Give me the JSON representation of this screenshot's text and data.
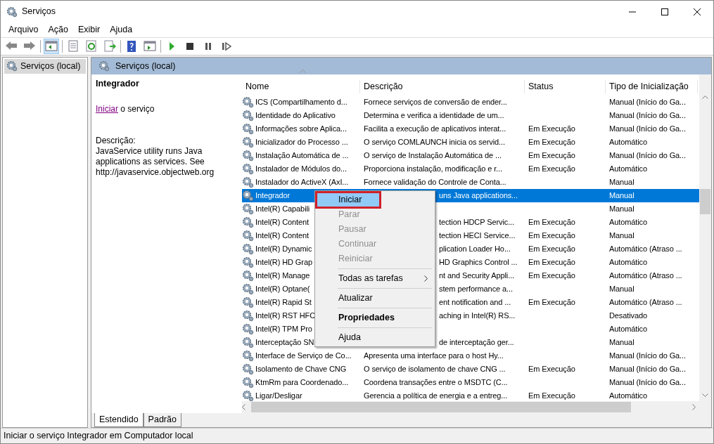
{
  "window": {
    "title": "Serviços"
  },
  "menu_bar": [
    "Arquivo",
    "Ação",
    "Exibir",
    "Ajuda"
  ],
  "toolbar": [
    {
      "kind": "back",
      "pressed": false
    },
    {
      "kind": "forward",
      "pressed": false
    },
    {
      "kind": "sep"
    },
    {
      "kind": "tree",
      "pressed": true
    },
    {
      "kind": "sep"
    },
    {
      "kind": "props",
      "pressed": false
    },
    {
      "kind": "refresh",
      "pressed": false
    },
    {
      "kind": "export",
      "pressed": false
    },
    {
      "kind": "sep"
    },
    {
      "kind": "help",
      "pressed": false
    },
    {
      "kind": "view",
      "pressed": false
    },
    {
      "kind": "sep"
    },
    {
      "kind": "play",
      "pressed": false
    },
    {
      "kind": "stop",
      "pressed": false
    },
    {
      "kind": "pause",
      "pressed": false
    },
    {
      "kind": "restart",
      "pressed": false
    }
  ],
  "tree": [
    {
      "label": "Serviços (local)",
      "selected": true
    }
  ],
  "pane_header": "Serviços (local)",
  "details": {
    "title": "Integrador",
    "action_link": "Iniciar",
    "action_text": "o serviço",
    "description_label": "Descrição:",
    "description": "JavaService utility runs Java applications as services. See http://javaservice.objectweb.org"
  },
  "table": {
    "columns": [
      "Nome",
      "Descrição",
      "Status",
      "Tipo de Inicialização"
    ],
    "rows": [
      {
        "name": "ICS (Compartilhamento d...",
        "description": "Fornece serviços de conversão de ender...",
        "status": "",
        "startup": "Manual (Início do Ga...",
        "selected": false,
        "covered": false
      },
      {
        "name": "Identidade do Aplicativo",
        "description": "Determina e verifica a identidade de um...",
        "status": "",
        "startup": "Manual (Início do Ga...",
        "selected": false,
        "covered": false
      },
      {
        "name": "Informações sobre Aplica...",
        "description": "Facilita a execução de aplicativos interat...",
        "status": "Em Execução",
        "startup": "Manual (Início do Ga...",
        "selected": false,
        "covered": false
      },
      {
        "name": "Inicializador do Processo ...",
        "description": "O serviço COMLAUNCH inicia os servid...",
        "status": "Em Execução",
        "startup": "Automático",
        "selected": false,
        "covered": false
      },
      {
        "name": "Instalação Automática de ...",
        "description": "O serviço de Instalação Automática de ...",
        "status": "Em Execução",
        "startup": "Manual (Início do Ga...",
        "selected": false,
        "covered": false
      },
      {
        "name": "Instalador de Módulos do...",
        "description": "Proporciona instalação, modificação e r...",
        "status": "Em Execução",
        "startup": "Automático",
        "selected": false,
        "covered": false
      },
      {
        "name": "Instalador do ActiveX (AxI...",
        "description": "Fornece validação do Controle de Conta...",
        "status": "",
        "startup": "Manual",
        "selected": false,
        "covered": false
      },
      {
        "name": "Integrador",
        "description": "uns Java applications...",
        "status": "",
        "startup": "Manual",
        "selected": true,
        "covered": true
      },
      {
        "name": "Intel(R) Capabili",
        "description": "",
        "status": "",
        "startup": "Manual",
        "selected": false
      },
      {
        "name": "Intel(R) Content",
        "description": "tection HDCP Servic...",
        "status": "Em Execução",
        "startup": "Automático",
        "selected": false,
        "covered": true
      },
      {
        "name": "Intel(R) Content",
        "description": "tection HECI Service...",
        "status": "Em Execução",
        "startup": "Manual",
        "selected": false,
        "covered": true
      },
      {
        "name": "Intel(R) Dynamic",
        "description": "plication Loader Ho...",
        "status": "Em Execução",
        "startup": "Automático (Atraso ...",
        "selected": false,
        "covered": true
      },
      {
        "name": "Intel(R) HD Grap",
        "description": "HD Graphics Control ...",
        "status": "Em Execução",
        "startup": "Automático",
        "selected": false,
        "covered": true
      },
      {
        "name": "Intel(R) Manage",
        "description": "nt and Security Appli...",
        "status": "Em Execução",
        "startup": "Automático (Atraso ...",
        "selected": false,
        "covered": true
      },
      {
        "name": "Intel(R) Optane(",
        "description": "stem performance a...",
        "status": "",
        "startup": "Manual",
        "selected": false,
        "covered": true
      },
      {
        "name": "Intel(R) Rapid St",
        "description": "ent notification and ...",
        "status": "Em Execução",
        "startup": "Automático (Atraso ...",
        "selected": false,
        "covered": true
      },
      {
        "name": "Intel(R) RST HFC",
        "description": "aching in Intel(R) RS...",
        "status": "",
        "startup": "Desativado",
        "selected": false,
        "covered": true
      },
      {
        "name": "Intel(R) TPM Pro",
        "description": "",
        "status": "",
        "startup": "Automático",
        "selected": false
      },
      {
        "name": "Interceptação SN",
        "description": "de interceptação ger...",
        "status": "",
        "startup": "Manual",
        "selected": false,
        "covered": true
      },
      {
        "name": "Interface de Serviço de Co...",
        "description": "Apresenta uma interface para o host Hy...",
        "status": "",
        "startup": "Manual (Início do Ga...",
        "selected": false,
        "covered": false
      },
      {
        "name": "Isolamento de Chave CNG",
        "description": "O serviço de isolamento de chave CNG ...",
        "status": "Em Execução",
        "startup": "Manual (Início do Ga...",
        "selected": false,
        "covered": false
      },
      {
        "name": "KtmRm para Coordenado...",
        "description": "Coordena transações entre o MSDTC (C...",
        "status": "",
        "startup": "Manual (Início do Ga...",
        "selected": false,
        "covered": false
      },
      {
        "name": "Ligar/Desligar",
        "description": "Gerencia a política de energia e a entreg...",
        "status": "Em Execução",
        "startup": "Automático",
        "selected": false,
        "covered": false
      }
    ]
  },
  "context_menu": [
    {
      "kind": "item",
      "label": "Iniciar",
      "disabled": false,
      "selected": true,
      "highlight_box": true
    },
    {
      "kind": "item",
      "label": "Parar",
      "disabled": true,
      "selected": false
    },
    {
      "kind": "item",
      "label": "Pausar",
      "disabled": true,
      "selected": false
    },
    {
      "kind": "item",
      "label": "Continuar",
      "disabled": true,
      "selected": false
    },
    {
      "kind": "item",
      "label": "Reiniciar",
      "disabled": true,
      "selected": false
    },
    {
      "kind": "separator"
    },
    {
      "kind": "submenu",
      "label": "Todas as tarefas",
      "disabled": false,
      "selected": false
    },
    {
      "kind": "separator"
    },
    {
      "kind": "item",
      "label": "Atualizar",
      "disabled": false,
      "selected": false
    },
    {
      "kind": "separator"
    },
    {
      "kind": "default",
      "label": "Propriedades",
      "disabled": false,
      "selected": false
    },
    {
      "kind": "separator"
    },
    {
      "kind": "item",
      "label": "Ajuda",
      "disabled": false,
      "selected": false
    }
  ],
  "view_tabs": [
    {
      "label": "Estendido",
      "selected": true
    },
    {
      "label": "Padrão",
      "selected": false
    }
  ],
  "status_bar": "Iniciar o serviço Integrador em Computador local"
}
